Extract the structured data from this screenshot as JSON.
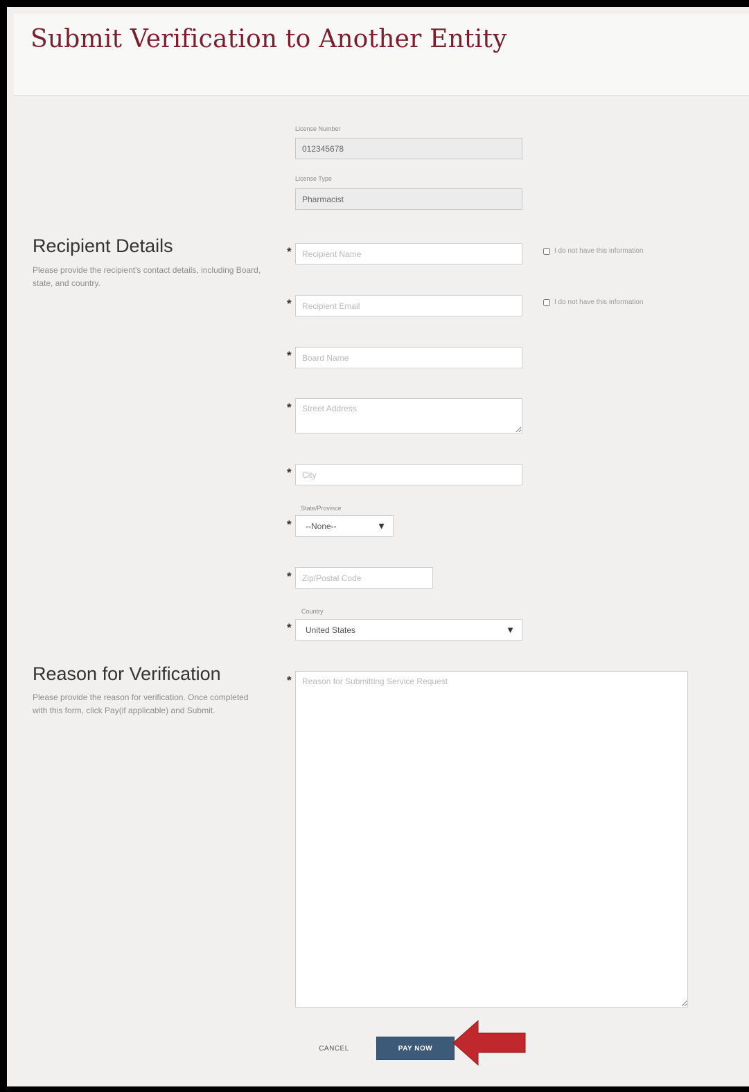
{
  "header": {
    "title": "Submit Verification to Another Entity"
  },
  "license": {
    "number_label": "License Number",
    "number_value": "012345678",
    "type_label": "License Type",
    "type_value": "Pharmacist"
  },
  "recipient_section": {
    "title": "Recipient Details",
    "description": "Please provide the recipient's contact details, including Board, state, and country."
  },
  "form": {
    "required_marker": "*",
    "recipient_name_placeholder": "Recipient Name",
    "recipient_email_placeholder": "Recipient Email",
    "no_info_label": "I do not have this information",
    "board_name_placeholder": "Board Name",
    "street_address_placeholder": "Street Address",
    "city_placeholder": "City",
    "state_label": "State/Province",
    "state_value": "--None--",
    "zip_placeholder": "Zip/Postal Code",
    "country_label": "Country",
    "country_value": "United States",
    "dropdown_caret": "▼",
    "reason_placeholder": "Reason for Submitting Service Request"
  },
  "reason_section": {
    "title": "Reason for Verification",
    "description": "Please provide the reason for verification. Once completed with this form, click Pay(if applicable) and Submit."
  },
  "actions": {
    "cancel_label": "CANCEL",
    "pay_label": "PAY NOW"
  },
  "colors": {
    "title": "#7a1f2e",
    "pay_button": "#3d5a78",
    "arrow": "#c0282d"
  }
}
